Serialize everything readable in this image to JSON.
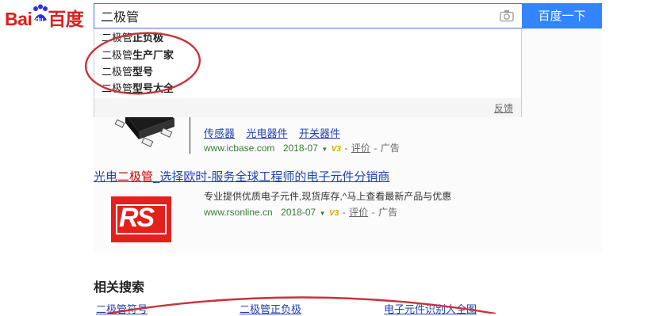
{
  "logo": {
    "text_bai": "Bai",
    "text_du": "du",
    "text_cn": "百度"
  },
  "search": {
    "query": "二极管",
    "button_label": "百度一下"
  },
  "suggestions": {
    "items": [
      {
        "prefix": "二极管",
        "suffix": "正负极"
      },
      {
        "prefix": "二极管",
        "suffix": "生产厂家"
      },
      {
        "prefix": "二极管",
        "suffix": "型号"
      },
      {
        "prefix": "二极管",
        "suffix": "型号大全"
      }
    ],
    "feedback": "反馈"
  },
  "result1": {
    "links": [
      "传感器",
      "光电器件",
      "开关器件"
    ],
    "url": "www.icbase.com",
    "date": "2018-07",
    "badge": "V3",
    "review": "评价",
    "ad": "广告"
  },
  "result2": {
    "title_before": "光电",
    "title_em": "二极管",
    "title_after": "_选择欧时-服务全球工程师的电子元件分销商",
    "desc": "专业提供优质电子元件,现货库存,^马上查看最新产品与优惠",
    "logo_text": "RS",
    "url": "www.rsonline.cn",
    "date": "2018-07",
    "badge": "V3",
    "review": "评价",
    "ad": "广告"
  },
  "related": {
    "title": "相关搜索",
    "links": [
      "二极管符号",
      "二极管正负极",
      "电子元件识别大全图"
    ]
  },
  "colors": {
    "brand_red": "#de1e1c",
    "button_blue": "#3385ff",
    "link_blue": "#2440b3",
    "annotation_red": "#c8323a"
  }
}
